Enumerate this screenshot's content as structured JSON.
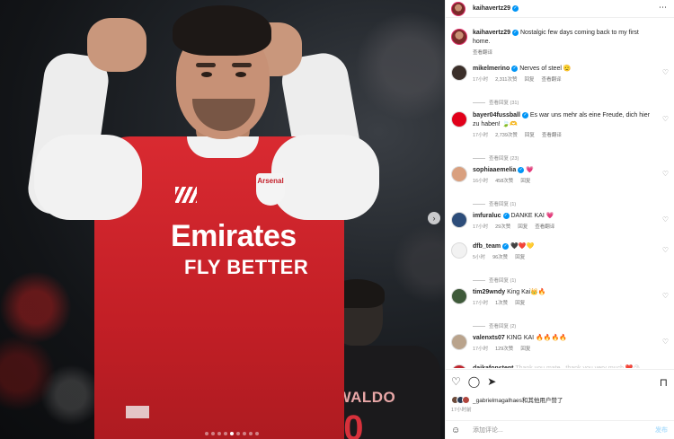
{
  "post": {
    "username": "kaihavertz29",
    "verified_mark": "✓",
    "more_icon": "⋯",
    "caption_user": "kaihavertz29",
    "caption": "Nostalgic few days coming back to my first home.",
    "caption_translate": "查看翻译"
  },
  "media": {
    "jersey_badge": "Arsenal",
    "sponsor_line1": "Emirates",
    "sponsor_line2": "FLY BETTER",
    "bg_player_name": "RWALDO",
    "bg_player_number": "20",
    "next_icon": "›",
    "slide_count": 9,
    "active_slide": 5
  },
  "comments": [
    {
      "user": "mikelmerino",
      "verified": true,
      "text": "Nerves of steel 🫡",
      "time": "17小时",
      "likes": "2,311次赞",
      "reply": "回复",
      "translate": "查看翻译",
      "replies": "查看回复 (31)"
    },
    {
      "user": "bayer04fussball",
      "verified": true,
      "text": "Es war uns mehr als eine Freude, dich hier zu haben! 🍃🫶",
      "time": "17小时",
      "likes": "2,739次赞",
      "reply": "回复",
      "translate": "查看翻译",
      "replies": "查看回复 (23)"
    },
    {
      "user": "sophiaaemelia",
      "verified": true,
      "text": "💗",
      "time": "16小时",
      "likes": "458次赞",
      "reply": "回复",
      "translate": "",
      "replies": "查看回复 (1)"
    },
    {
      "user": "imfuraluc",
      "verified": true,
      "text": "DANKE KAI 💗",
      "time": "17小时",
      "likes": "29次赞",
      "reply": "回复",
      "translate": "查看翻译",
      "replies": ""
    },
    {
      "user": "dfb_team",
      "verified": true,
      "text": "🖤❤️💛",
      "time": "5小时",
      "likes": "96次赞",
      "reply": "回复",
      "translate": "",
      "replies": "查看回复 (1)"
    },
    {
      "user": "tim29wndy",
      "verified": false,
      "text": "King Kai👑🔥",
      "time": "17小时",
      "likes": "1次赞",
      "reply": "回复",
      "translate": "",
      "replies": "查看回复 (2)"
    },
    {
      "user": "valenxts07",
      "verified": false,
      "text": "KING KAI 🔥🔥🔥🔥",
      "time": "17小时",
      "likes": "129次赞",
      "reply": "回复",
      "translate": "",
      "replies": ""
    },
    {
      "user": "daikafonstent",
      "verified": false,
      "text": "Thank you mate , thank you very much ❤️😘",
      "time": "",
      "likes": "",
      "reply": "",
      "translate": "",
      "replies": ""
    }
  ],
  "actions": {
    "like_icon": "♡",
    "comment_icon": "◯",
    "share_icon": "➤",
    "bookmark_icon": "⊓",
    "likes_text": "_gabrielmagalhaes和其他用户赞了",
    "timestamp": "17小时前"
  },
  "add_comment": {
    "emoji_icon": "☺",
    "placeholder": "添加评论...",
    "post_label": "发布"
  },
  "colors": {
    "accent": "#0095f6",
    "jersey_red": "#d92a31",
    "ring": "#e1306c"
  }
}
